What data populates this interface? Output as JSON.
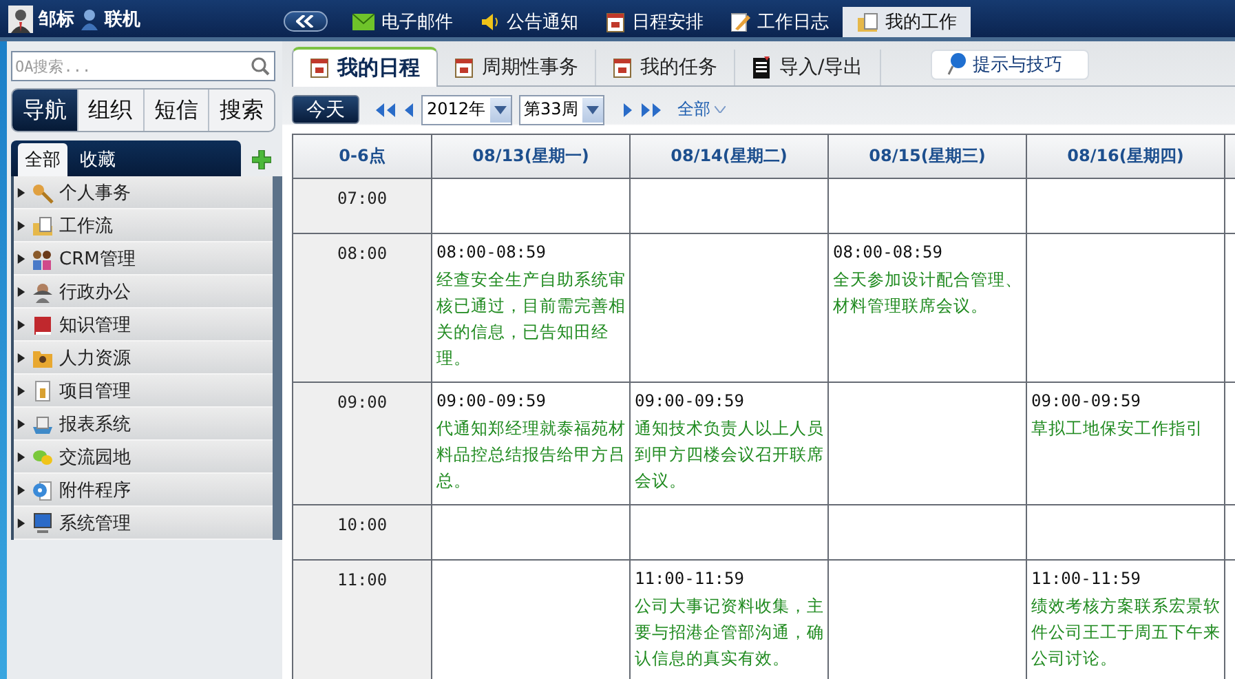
{
  "top_bar": {
    "user_name": "邹标",
    "status": "联机",
    "nav": [
      {
        "label": "电子邮件",
        "selected": false
      },
      {
        "label": "公告通知",
        "selected": false
      },
      {
        "label": "日程安排",
        "selected": false
      },
      {
        "label": "工作日志",
        "selected": false
      },
      {
        "label": "我的工作",
        "selected": true
      }
    ]
  },
  "sidebar": {
    "search": {
      "placeholder": "OA搜索..."
    },
    "tabs": [
      {
        "label": "导航",
        "selected": true
      },
      {
        "label": "组织",
        "selected": false
      },
      {
        "label": "短信",
        "selected": false
      },
      {
        "label": "搜索",
        "selected": false
      }
    ],
    "list_tabs": [
      {
        "label": "全部",
        "selected": true
      },
      {
        "label": "收藏",
        "selected": false
      }
    ],
    "items": [
      {
        "label": "个人事务",
        "expanded": false
      },
      {
        "label": "工作流",
        "expanded": false
      },
      {
        "label": "CRM管理",
        "expanded": false
      },
      {
        "label": "行政办公",
        "expanded": false
      },
      {
        "label": "知识管理",
        "expanded": false
      },
      {
        "label": "人力资源",
        "expanded": false
      },
      {
        "label": "项目管理",
        "expanded": false
      },
      {
        "label": "报表系统",
        "expanded": false
      },
      {
        "label": "交流园地",
        "expanded": false
      },
      {
        "label": "附件程序",
        "expanded": false
      },
      {
        "label": "系统管理",
        "expanded": false
      }
    ]
  },
  "main": {
    "tabs": [
      {
        "label": "我的日程",
        "selected": true
      },
      {
        "label": "周期性事务",
        "selected": false
      },
      {
        "label": "我的任务",
        "selected": false
      },
      {
        "label": "导入/导出",
        "selected": false
      }
    ],
    "tip_button": "提示与技巧",
    "toolbar": {
      "today": "今天",
      "year": "2012年",
      "week": "第33周",
      "filter": "全部"
    }
  },
  "schedule": {
    "columns": [
      "0-6点",
      "08/13(星期一)",
      "08/14(星期二)",
      "08/15(星期三)",
      "08/16(星期四)"
    ],
    "rows": [
      {
        "cells": [
          {
            "kind": "time",
            "text": "07:00"
          },
          {
            "kind": "empty"
          },
          {
            "kind": "empty"
          },
          {
            "kind": "empty"
          },
          {
            "kind": "empty"
          }
        ]
      },
      {
        "cells": [
          {
            "kind": "time",
            "text": "08:00"
          },
          {
            "kind": "event",
            "time": "08:00-08:59",
            "text": "经查安全生产自助系统审核已通过，目前需完善相关的信息，已告知田经理。"
          },
          {
            "kind": "empty"
          },
          {
            "kind": "event",
            "time": "08:00-08:59",
            "text": "全天参加设计配合管理、材料管理联席会议。"
          },
          {
            "kind": "empty"
          }
        ]
      },
      {
        "cells": [
          {
            "kind": "time",
            "text": "09:00"
          },
          {
            "kind": "event",
            "time": "09:00-09:59",
            "text": "代通知郑经理就泰福苑材料品控总结报告给甲方吕总。"
          },
          {
            "kind": "event",
            "time": "09:00-09:59",
            "text": "通知技术负责人以上人员到甲方四楼会议召开联席会议。"
          },
          {
            "kind": "empty"
          },
          {
            "kind": "event",
            "time": "09:00-09:59",
            "text": "草拟工地保安工作指引"
          }
        ]
      },
      {
        "cells": [
          {
            "kind": "time",
            "text": "10:00"
          },
          {
            "kind": "empty"
          },
          {
            "kind": "empty"
          },
          {
            "kind": "empty"
          },
          {
            "kind": "empty"
          }
        ]
      },
      {
        "cells": [
          {
            "kind": "time",
            "text": "11:00"
          },
          {
            "kind": "empty"
          },
          {
            "kind": "event",
            "time": "11:00-11:59",
            "text": "公司大事记资料收集，主要与招港企管部沟通，确认信息的真实有效。"
          },
          {
            "kind": "empty"
          },
          {
            "kind": "event",
            "time": "11:00-11:59",
            "text": "绩效考核方案联系宏景软件公司王工于周五下午来公司讨论。"
          }
        ]
      }
    ]
  }
}
